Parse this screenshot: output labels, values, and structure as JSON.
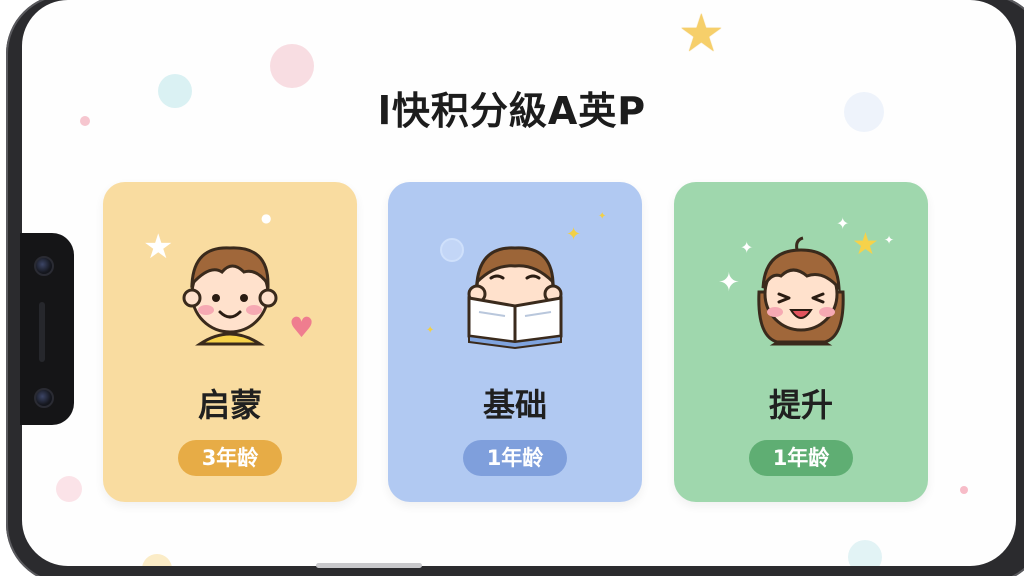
{
  "title": "l快积分級A英P",
  "cards": [
    {
      "label": "启蒙",
      "badge": "3年龄",
      "bg": "#f9dca0",
      "badge_color": "#e7ac46"
    },
    {
      "label": "基础",
      "badge": "1年龄",
      "bg": "#b1c9f2",
      "badge_color": "#7f9fdc"
    },
    {
      "label": "提升",
      "badge": "1年龄",
      "bg": "#9fd7ad",
      "badge_color": "#5fae73"
    }
  ],
  "icons": {
    "card1": "smiling-boy-icon",
    "card2": "boy-reading-book-icon",
    "card3": "laughing-girl-icon",
    "decor_star": "star-icon",
    "heart": "heart-icon"
  }
}
